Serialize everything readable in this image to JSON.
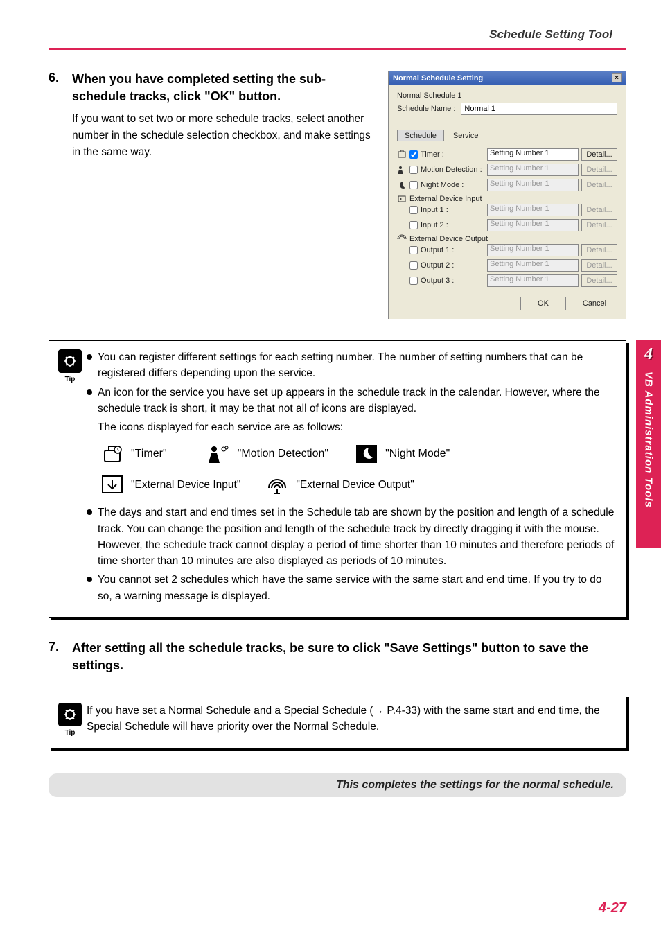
{
  "header": {
    "section_title": "Schedule Setting Tool"
  },
  "step6": {
    "num": "6.",
    "title": "When you have completed setting the sub-schedule tracks, click \"OK\" button.",
    "desc": "If you want to set two or more schedule tracks, select another number in the schedule selection checkbox, and make settings in the same way."
  },
  "dialog": {
    "title": "Normal Schedule Setting",
    "schedule_header": "Normal Schedule 1",
    "name_label": "Schedule Name :",
    "name_value": "Normal 1",
    "tab_schedule": "Schedule",
    "tab_service": "Service",
    "select_text": "Setting Number 1",
    "detail_btn": "Detail...",
    "rows": {
      "timer": "Timer :",
      "motion": "Motion Detection :",
      "night": "Night Mode :",
      "ext_in_head": "External Device Input",
      "input1": "Input 1 :",
      "input2": "Input 2 :",
      "ext_out_head": "External Device Output",
      "output1": "Output 1 :",
      "output2": "Output 2 :",
      "output3": "Output 3 :"
    },
    "ok": "OK",
    "cancel": "Cancel"
  },
  "tip1": {
    "label": "Tip",
    "b1": "You can register different settings for each setting number. The number of setting numbers that can be registered differs depending upon the service.",
    "b2": "An icon for the service you have set up appears in the schedule track in the calendar. However, where the schedule track is short, it may be that not all of icons are displayed.",
    "b2sub": "The icons displayed for each service are as follows:",
    "icon_timer": "\"Timer\"",
    "icon_motion": "\"Motion Detection\"",
    "icon_night": "\"Night Mode\"",
    "icon_extin": "\"External Device Input\"",
    "icon_extout": "\"External Device Output\"",
    "b3": "The days and start and end times set in the Schedule tab are shown by the position and length of a schedule track. You can change the position and length of the schedule track by directly dragging it with the mouse. However, the schedule track cannot display a period of time shorter than 10 minutes and therefore periods of time shorter than 10 minutes are also displayed as periods of 10 minutes.",
    "b4": "You cannot set 2 schedules which have the same service with the same start and end time. If you try to do so, a warning message is displayed."
  },
  "step7": {
    "num": "7.",
    "title": "After setting all the schedule tracks, be sure to click \"Save Settings\" button to save the settings."
  },
  "tip2": {
    "label": "Tip",
    "text": "If you have set a Normal Schedule and a Special Schedule (→ P.4-33) with the same start and end time, the Special Schedule will have priority over the Normal Schedule."
  },
  "completion": "This completes the settings for the normal schedule.",
  "page_num": "4-27",
  "side": {
    "chapter": "4",
    "label": "VB Administration Tools"
  }
}
